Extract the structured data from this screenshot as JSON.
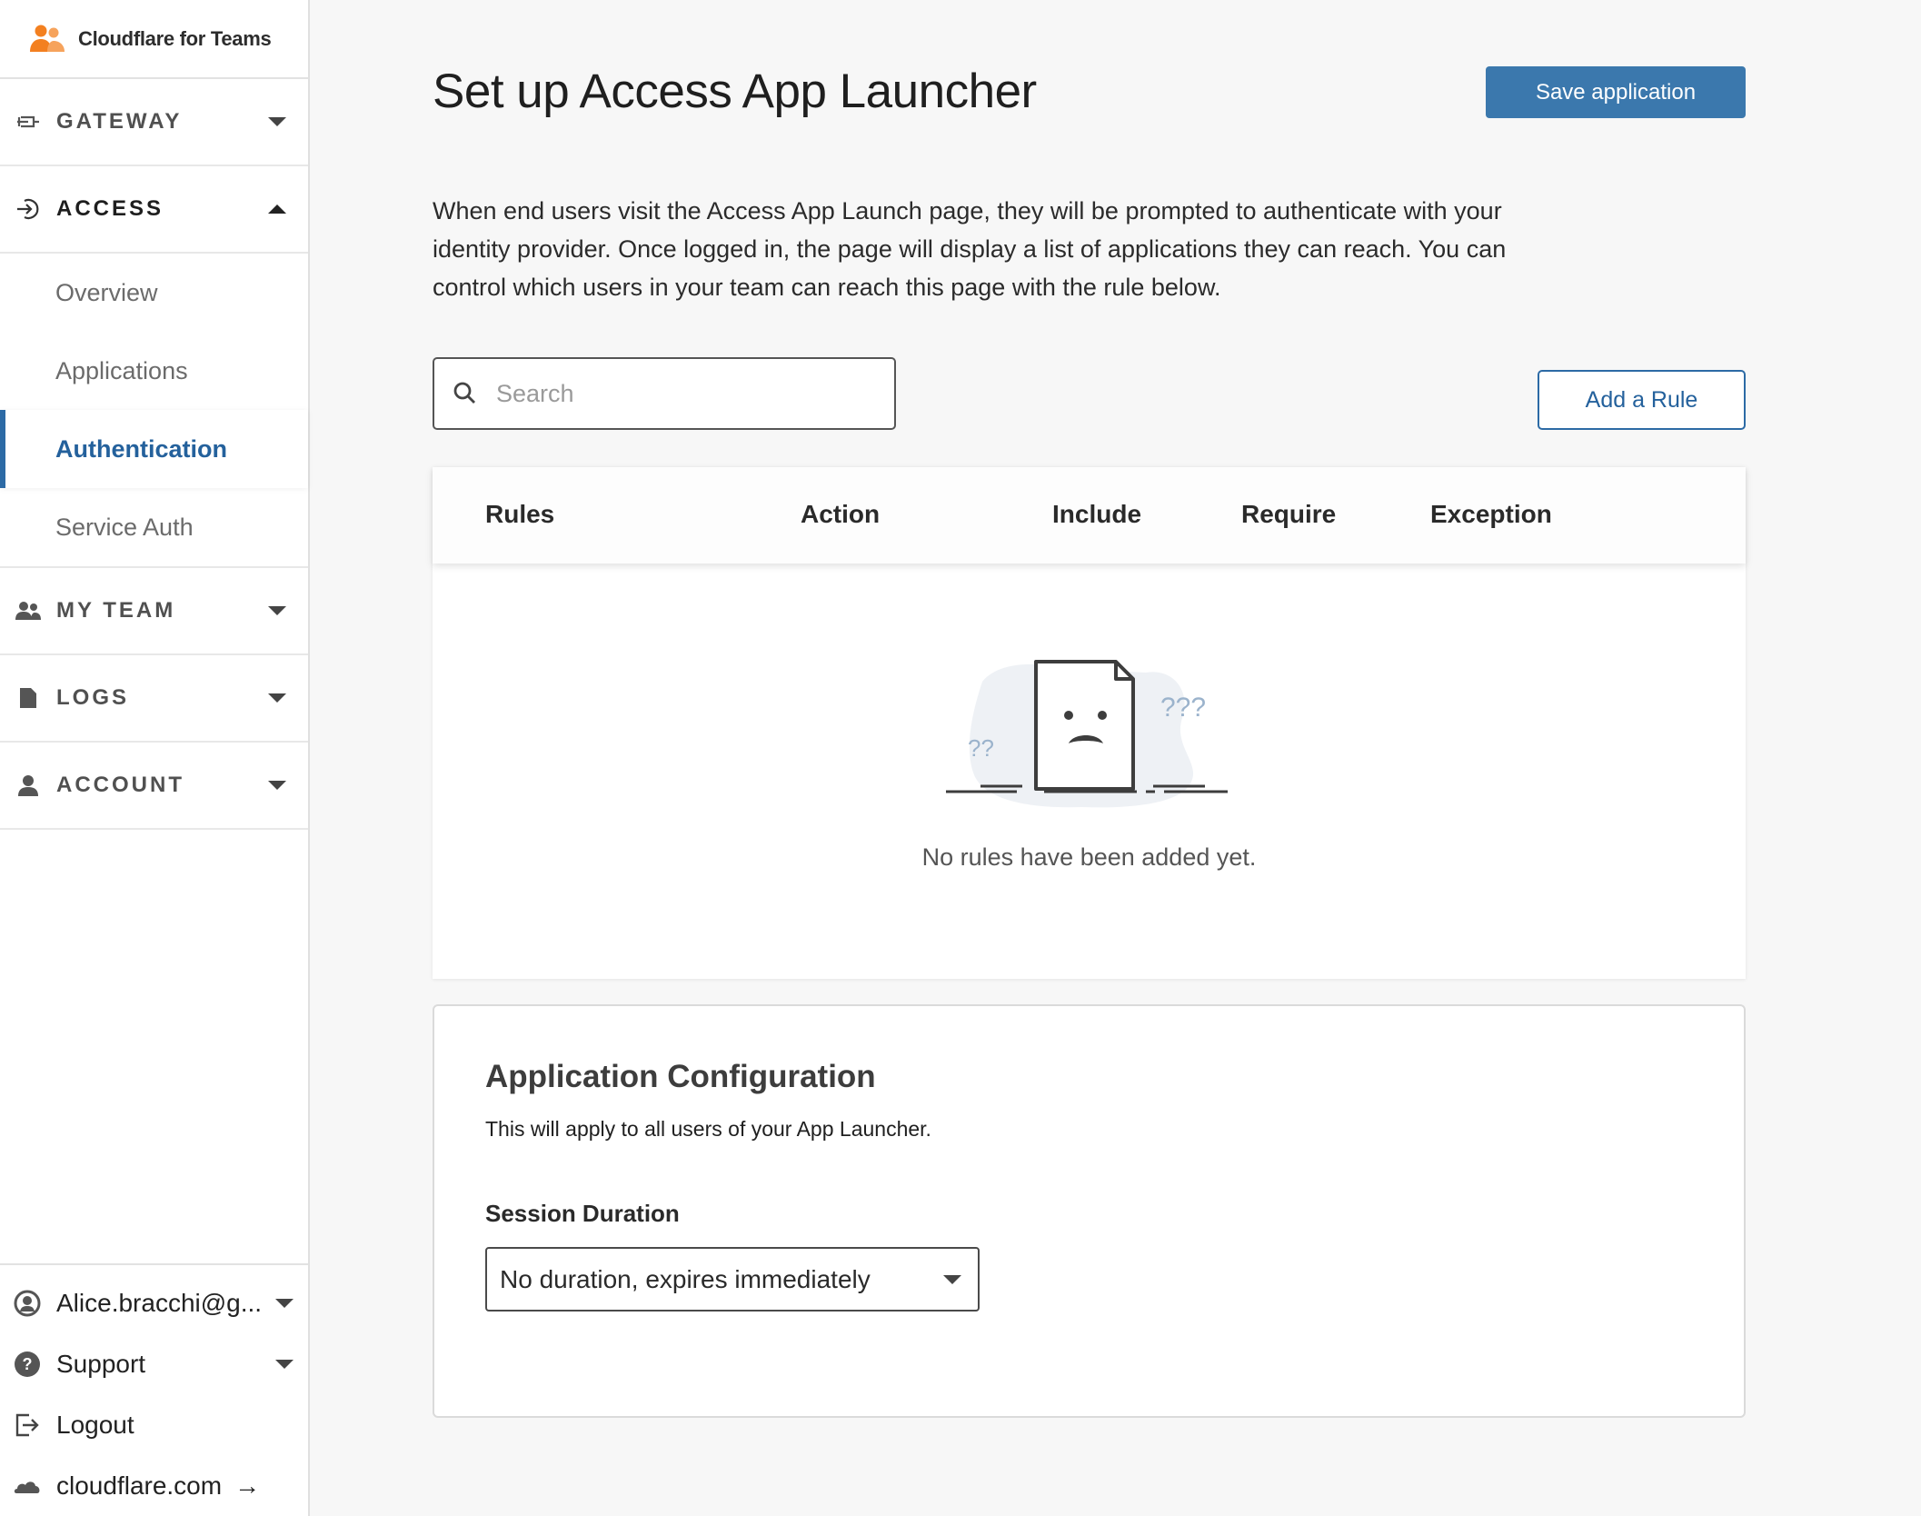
{
  "brand": {
    "name": "Cloudflare for Teams"
  },
  "sidebar": {
    "sections": {
      "gateway": {
        "label": "GATEWAY"
      },
      "access": {
        "label": "ACCESS"
      },
      "my_team": {
        "label": "MY TEAM"
      },
      "logs": {
        "label": "LOGS"
      },
      "account": {
        "label": "ACCOUNT"
      }
    },
    "access_items": [
      "Overview",
      "Applications",
      "Authentication",
      "Service Auth"
    ],
    "active_item": "Authentication",
    "footer": {
      "user": "Alice.bracchi@g...",
      "support": "Support",
      "logout": "Logout",
      "site": "cloudflare.com"
    }
  },
  "main": {
    "title": "Set up Access App Launcher",
    "save_label": "Save application",
    "intro": "When end users visit the Access App Launch page, they will be prompted to authenticate with your identity provider. Once logged in, the page will display a list of applications they can reach. You can control which users in your team can reach this page with the rule below.",
    "search": {
      "placeholder": "Search"
    },
    "add_rule_label": "Add a Rule",
    "table": {
      "columns": [
        "Rules",
        "Action",
        "Include",
        "Require",
        "Exception"
      ],
      "empty_message": "No rules have been added yet."
    },
    "config": {
      "title": "Application Configuration",
      "subtitle": "This will apply to all users of your App Launcher.",
      "session_label": "Session Duration",
      "session_value": "No duration, expires immediately"
    }
  },
  "colors": {
    "accent": "#3b78ad",
    "active_nav": "#24619c",
    "brand_orange": "#f38020"
  }
}
